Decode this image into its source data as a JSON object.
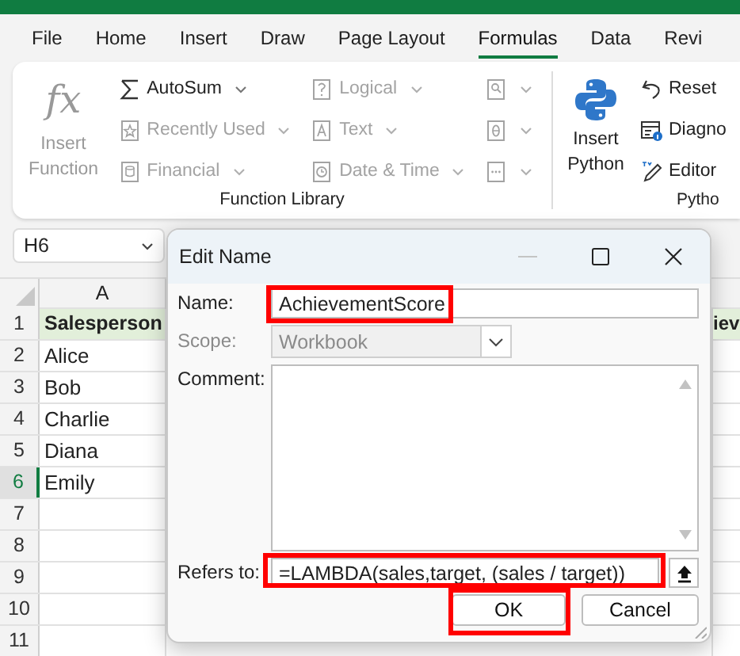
{
  "ribbon_tabs": [
    {
      "label": "File",
      "selected": false
    },
    {
      "label": "Home",
      "selected": false
    },
    {
      "label": "Insert",
      "selected": false
    },
    {
      "label": "Draw",
      "selected": false
    },
    {
      "label": "Page Layout",
      "selected": false
    },
    {
      "label": "Formulas",
      "selected": true
    },
    {
      "label": "Data",
      "selected": false
    },
    {
      "label": "Revi",
      "selected": false
    }
  ],
  "ribbon_groups": [
    {
      "label": "Function Library",
      "large": {
        "glyph": "fx",
        "label": "Insert Function",
        "disabled": true
      },
      "columns": [
        [
          {
            "label": "AutoSum",
            "disabled": false,
            "dropdown": true
          },
          {
            "label": "Recently Used",
            "disabled": true,
            "dropdown": true
          },
          {
            "label": "Financial",
            "disabled": true,
            "dropdown": true
          }
        ],
        [
          {
            "label": "Logical",
            "disabled": true,
            "dropdown": true
          },
          {
            "label": "Text",
            "disabled": true,
            "dropdown": true
          },
          {
            "label": "Date & Time",
            "disabled": true,
            "dropdown": true
          }
        ],
        [
          {
            "disabled": true,
            "dropdown": true
          },
          {
            "disabled": true,
            "dropdown": true
          },
          {
            "disabled": true,
            "dropdown": true
          }
        ]
      ]
    },
    {
      "label": "Pytho",
      "large": {
        "label": "Insert Python",
        "disabled": false
      },
      "columns": [
        [
          {
            "label": "Reset",
            "disabled": false,
            "dropdown": false
          },
          {
            "label": "Diagno",
            "disabled": false,
            "dropdown": false
          },
          {
            "label": "Editor",
            "disabled": false,
            "dropdown": false
          }
        ]
      ]
    }
  ],
  "sheet": {
    "name_box": "H6",
    "column_headers": [
      "A"
    ],
    "rows": [
      {
        "number": "1",
        "selected": false,
        "kind": "header",
        "cells": [
          "Salesperson",
          "iev"
        ]
      },
      {
        "number": "2",
        "selected": false,
        "kind": "data",
        "cells": [
          "Alice"
        ]
      },
      {
        "number": "3",
        "selected": false,
        "kind": "data",
        "cells": [
          "Bob"
        ]
      },
      {
        "number": "4",
        "selected": false,
        "kind": "data",
        "cells": [
          "Charlie"
        ]
      },
      {
        "number": "5",
        "selected": false,
        "kind": "data",
        "cells": [
          "Diana"
        ]
      },
      {
        "number": "6",
        "selected": true,
        "kind": "data",
        "cells": [
          "Emily"
        ]
      },
      {
        "number": "7",
        "selected": false,
        "kind": "data"
      },
      {
        "number": "8",
        "selected": false,
        "kind": "data"
      },
      {
        "number": "9",
        "selected": false,
        "kind": "data"
      },
      {
        "number": "10",
        "selected": false,
        "kind": "data"
      },
      {
        "number": "11",
        "selected": false,
        "kind": "data"
      }
    ]
  },
  "dialog": {
    "title": "Edit Name",
    "fields": [
      {
        "kind": "text",
        "label": "Name:",
        "value": "AchievementScore",
        "highlighted": true
      },
      {
        "kind": "select",
        "label": "Scope:",
        "value": "Workbook",
        "disabled": true
      },
      {
        "kind": "textarea",
        "label": "Comment:"
      },
      {
        "kind": "reference",
        "label": "Refers to:",
        "value": "=LAMBDA(sales,target, (sales / target))",
        "highlighted": true
      }
    ],
    "buttons": [
      {
        "label": "OK",
        "highlighted": true
      },
      {
        "label": "Cancel",
        "highlighted": false
      }
    ]
  }
}
